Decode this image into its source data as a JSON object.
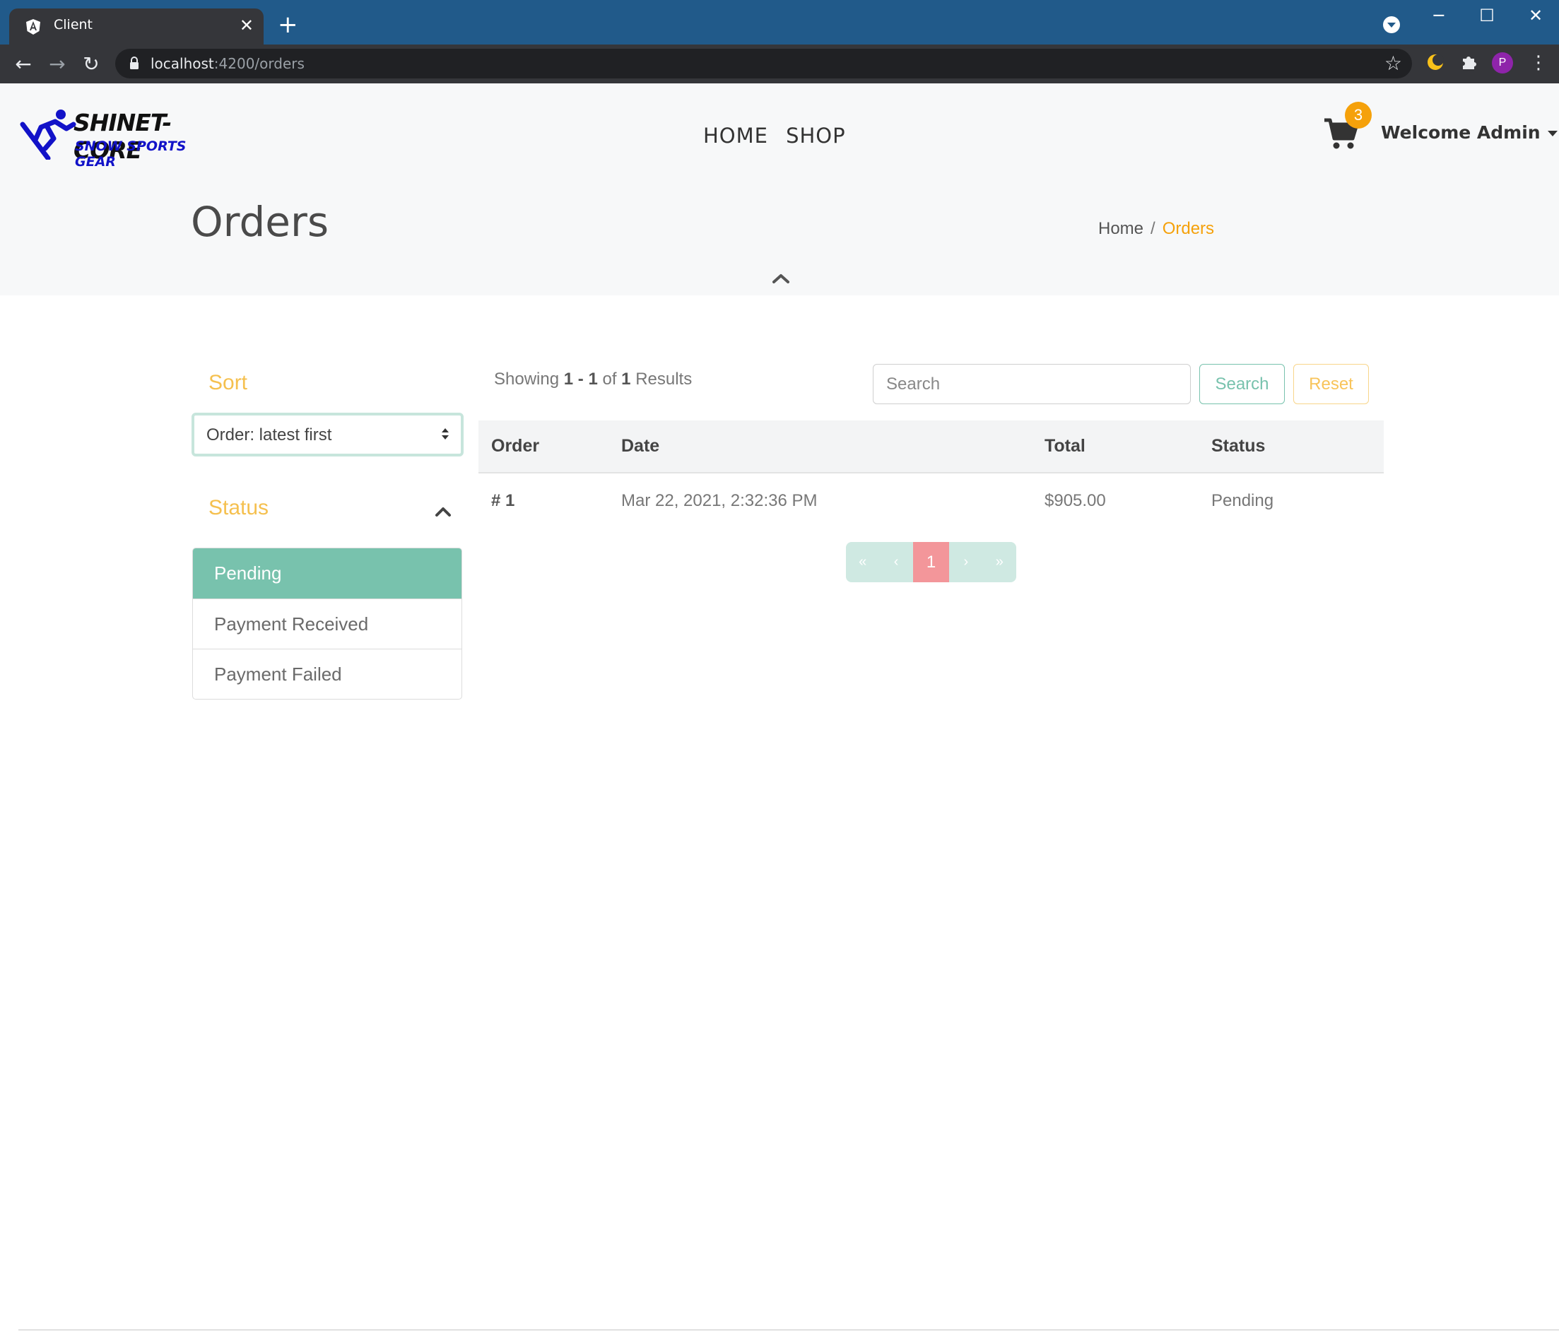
{
  "browser": {
    "tab_title": "Client",
    "url_host": "localhost",
    "url_path": ":4200/orders",
    "profile_initial": "P"
  },
  "header": {
    "logo_line1": "SHINET-CORE",
    "logo_line2": "SNOW SPORTS GEAR",
    "nav": [
      "HOME",
      "SHOP"
    ],
    "cart_count": "3",
    "welcome": "Welcome Admin"
  },
  "page": {
    "title": "Orders",
    "breadcrumb": {
      "home": "Home",
      "separator": "/",
      "current": "Orders"
    }
  },
  "sidebar": {
    "sort_heading": "Sort",
    "sort_value": "Order: latest first",
    "status_heading": "Status",
    "status_items": [
      {
        "label": "Pending",
        "active": true
      },
      {
        "label": "Payment Received",
        "active": false
      },
      {
        "label": "Payment Failed",
        "active": false
      }
    ]
  },
  "results": {
    "prefix": "Showing",
    "from": "1",
    "dash": "-",
    "to": "1",
    "of": "of",
    "total": "1",
    "suffix": "Results"
  },
  "search": {
    "placeholder": "Search",
    "search_label": "Search",
    "reset_label": "Reset"
  },
  "table": {
    "headers": [
      "Order",
      "Date",
      "Total",
      "Status"
    ],
    "rows": [
      {
        "order": "# 1",
        "date": "Mar 22, 2021, 2:32:36 PM",
        "total": "$905.00",
        "status": "Pending"
      }
    ]
  },
  "pagination": {
    "first": "«",
    "prev": "‹",
    "current": "1",
    "next": "›",
    "last": "»"
  },
  "colors": {
    "accent_mint": "#78c2ad",
    "accent_orange": "#f5a10b",
    "heading_yellow": "#f5c04f",
    "pagination_active": "#f3969a",
    "chrome_tabbar": "#215a8a"
  },
  "icons": [
    "angular-icon",
    "close-icon",
    "plus-icon",
    "tab-search-icon",
    "back-arrow-icon",
    "forward-arrow-icon",
    "reload-icon",
    "lock-icon",
    "star-icon",
    "moon-extension-icon",
    "puzzle-icon",
    "kebab-menu-icon",
    "snowboarder-icon",
    "cart-icon",
    "caret-down-icon",
    "chevron-up-icon",
    "sort-arrows-icon"
  ]
}
